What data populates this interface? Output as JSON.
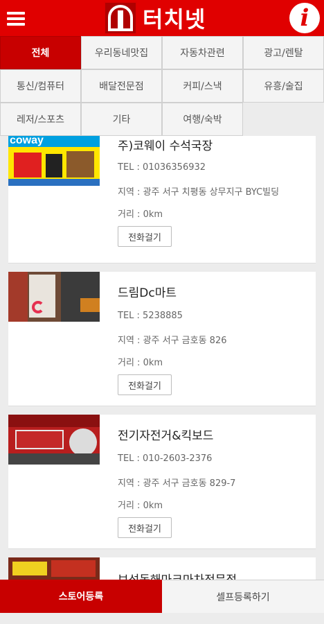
{
  "header": {
    "title": "터치넷",
    "menu_icon": "menu-icon",
    "info_icon": "info-icon",
    "info_glyph": "i"
  },
  "categories": [
    "전체",
    "우리동네맛집",
    "자동차관련",
    "광고/렌탈",
    "통신/컴퓨터",
    "배달전문점",
    "커피/스낵",
    "유흥/술집",
    "레저/스포츠",
    "기타",
    "여행/숙박"
  ],
  "active_category": "전체",
  "stores": [
    {
      "name": "주)코웨이 수석국장",
      "tel": "TEL : 01036356932",
      "area": "지역 : 광주 서구 치평동 상무지구 BYC빌딩",
      "distance": "거리 : 0km",
      "call": "전화걸기",
      "thumb_text": "coway"
    },
    {
      "name": "드림Dc마트",
      "tel": "TEL : 5238885",
      "area": "지역 : 광주 서구 금호동 826",
      "distance": "거리 : 0km",
      "call": "전화걸기"
    },
    {
      "name": "전기자전거&킥보드",
      "tel": "TEL : 010-2603-2376",
      "area": "지역 : 광주 서구 금호동 829-7",
      "distance": "거리 : 0km",
      "call": "전화걸기"
    },
    {
      "name": "보성동해마크마차전문점"
    }
  ],
  "bottom": {
    "store_register": "스토어등록",
    "self_register": "셀프등록하기"
  },
  "colors": {
    "brand": "#e00000",
    "active": "#c80000"
  }
}
